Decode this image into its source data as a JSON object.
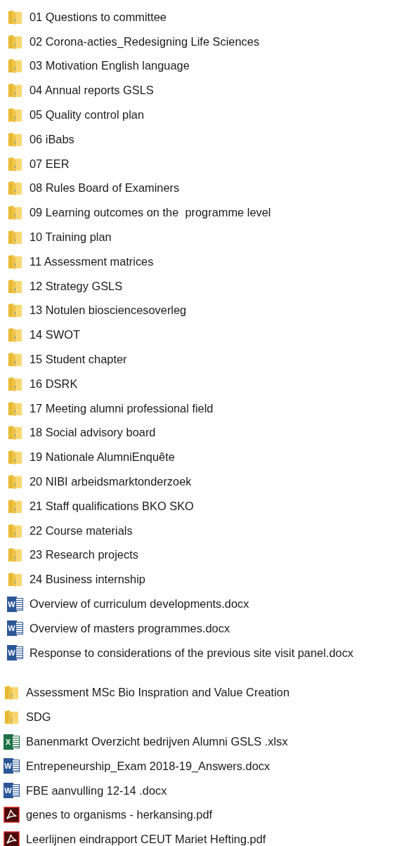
{
  "groups": [
    {
      "items": [
        {
          "kind": "folder",
          "name": "01 Questions to committee"
        },
        {
          "kind": "folder",
          "name": "02 Corona-acties_Redesigning Life Sciences"
        },
        {
          "kind": "folder",
          "name": "03 Motivation English language"
        },
        {
          "kind": "folder",
          "name": "04 Annual reports GSLS"
        },
        {
          "kind": "folder",
          "name": "05 Quality control plan"
        },
        {
          "kind": "folder",
          "name": "06 iBabs"
        },
        {
          "kind": "folder",
          "name": "07 EER"
        },
        {
          "kind": "folder",
          "name": "08 Rules Board of Examiners"
        },
        {
          "kind": "folder",
          "name": "09 Learning outcomes on the  programme level"
        },
        {
          "kind": "folder",
          "name": "10 Training plan"
        },
        {
          "kind": "folder",
          "name": "11 Assessment matrices"
        },
        {
          "kind": "folder",
          "name": "12 Strategy GSLS"
        },
        {
          "kind": "folder",
          "name": "13 Notulen biosciencesoverleg"
        },
        {
          "kind": "folder",
          "name": "14 SWOT"
        },
        {
          "kind": "folder",
          "name": "15 Student chapter"
        },
        {
          "kind": "folder",
          "name": "16 DSRK"
        },
        {
          "kind": "folder",
          "name": "17 Meeting alumni professional field"
        },
        {
          "kind": "folder",
          "name": "18 Social advisory board"
        },
        {
          "kind": "folder",
          "name": "19 Nationale AlumniEnquête"
        },
        {
          "kind": "folder",
          "name": "20 NIBI arbeidsmarktonderzoek"
        },
        {
          "kind": "folder",
          "name": "21 Staff qualifications BKO SKO"
        },
        {
          "kind": "folder",
          "name": "22 Course materials"
        },
        {
          "kind": "folder",
          "name": "23 Research projects"
        },
        {
          "kind": "folder",
          "name": "24 Business internship"
        },
        {
          "kind": "word",
          "icon_letter": "W",
          "name": "Overview of curriculum developments.docx"
        },
        {
          "kind": "word",
          "icon_letter": "W",
          "name": "Overview of masters programmes.docx"
        },
        {
          "kind": "word",
          "icon_letter": "W",
          "name": "Response to considerations of the previous site visit panel.docx"
        }
      ]
    },
    {
      "items": [
        {
          "kind": "folder",
          "name": "Assessment MSc Bio Inspration and Value Creation"
        },
        {
          "kind": "folder",
          "name": "SDG"
        },
        {
          "kind": "excel",
          "icon_letter": "X",
          "name": "Banenmarkt Overzicht bedrijven Alumni GSLS .xlsx"
        },
        {
          "kind": "word",
          "icon_letter": "W",
          "name": "Entrepeneurship_Exam 2018-19_Answers.docx"
        },
        {
          "kind": "word",
          "icon_letter": "W",
          "name": "FBE aanvulling 12-14 .docx"
        },
        {
          "kind": "pdf",
          "name": "genes to organisms - herkansing.pdf"
        },
        {
          "kind": "pdf",
          "name": "Leerlijnen eindrapport CEUT Mariet Hefting.pdf"
        }
      ]
    }
  ]
}
